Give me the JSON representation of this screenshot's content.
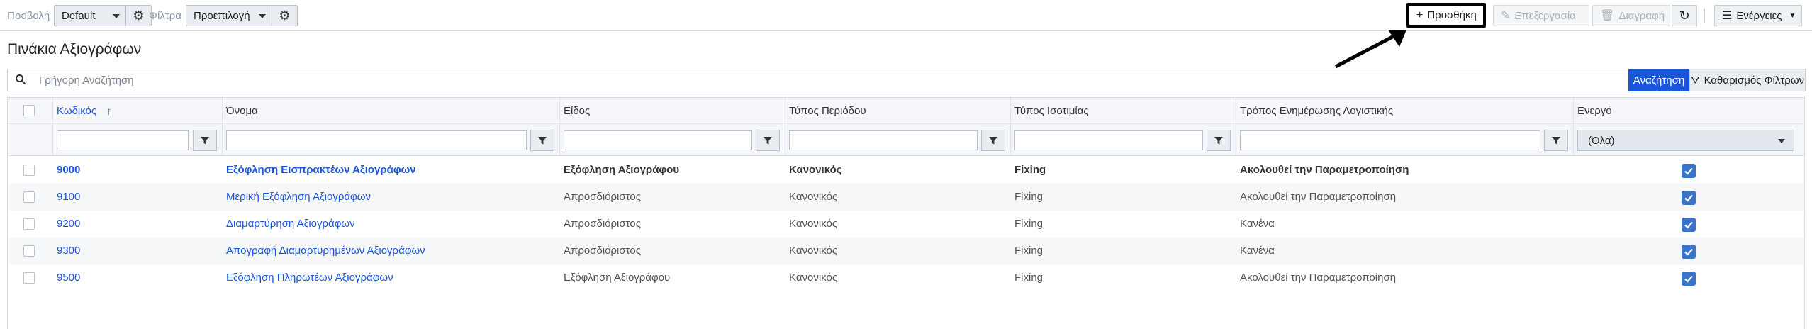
{
  "toolbar": {
    "view_label": "Προβολή",
    "view_value": "Default",
    "filters_label": "Φίλτρα",
    "filters_value": "Προεπιλογή",
    "add_label": "Προσθήκη",
    "edit_label": "Επεξεργασία",
    "delete_label": "Διαγραφή",
    "actions_label": "Ενέργειες"
  },
  "page": {
    "title": "Πινάκια Αξιογράφων"
  },
  "search": {
    "placeholder": "Γρήγορη Αναζήτηση",
    "value": "",
    "search_button": "Αναζήτηση",
    "clear_button": "Καθαρισμός Φίλτρων"
  },
  "columns": [
    "Κωδικός",
    "Όνομα",
    "Είδος",
    "Τύπος Περιόδου",
    "Τύπος Ισοτιμίας",
    "Τρόπος Ενημέρωσης Λογιστικής",
    "Ενεργό"
  ],
  "filters": {
    "active_value": "(Όλα)"
  },
  "rows": [
    {
      "code": "9000",
      "name": "Εξόφληση Εισπρακτέων Αξιογράφων",
      "kind": "Εξόφληση Αξιογράφου",
      "period": "Κανονικός",
      "rate": "Fixing",
      "accounting": "Ακολουθεί την Παραμετροποίηση",
      "active": true
    },
    {
      "code": "9100",
      "name": "Μερική Εξόφληση Αξιογράφων",
      "kind": "Απροσδιόριστος",
      "period": "Κανονικός",
      "rate": "Fixing",
      "accounting": "Ακολουθεί την Παραμετροποίηση",
      "active": true
    },
    {
      "code": "9200",
      "name": "Διαμαρτύρηση Αξιογράφων",
      "kind": "Απροσδιόριστος",
      "period": "Κανονικός",
      "rate": "Fixing",
      "accounting": "Κανένα",
      "active": true
    },
    {
      "code": "9300",
      "name": "Απογραφή Διαμαρτυρημένων Αξιογράφων",
      "kind": "Απροσδιόριστος",
      "period": "Κανονικός",
      "rate": "Fixing",
      "accounting": "Κανένα",
      "active": true
    },
    {
      "code": "9500",
      "name": "Εξόφληση Πληρωτέων Αξιογράφων",
      "kind": "Εξόφληση Αξιογράφου",
      "period": "Κανονικός",
      "rate": "Fixing",
      "accounting": "Ακολουθεί την Παραμετροποίηση",
      "active": true
    }
  ],
  "colors": {
    "accent": "#1a56db",
    "checkbox": "#3a74c9",
    "highlight_border": "#000000"
  }
}
